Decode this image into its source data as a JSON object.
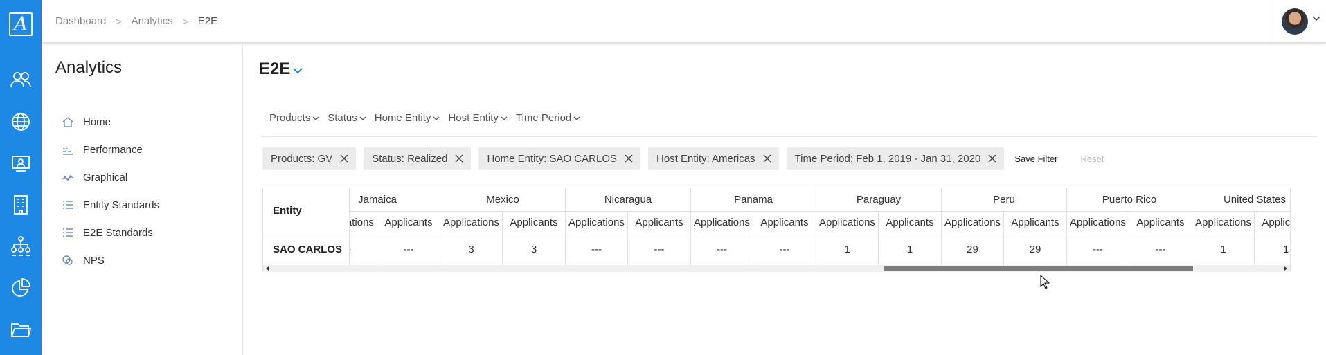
{
  "app": {
    "logo_letter": "A"
  },
  "breadcrumb": {
    "items": [
      "Dashboard",
      "Analytics",
      "E2E"
    ]
  },
  "sidebar": {
    "title": "Analytics",
    "items": [
      {
        "label": "Home",
        "icon": "home-icon"
      },
      {
        "label": "Performance",
        "icon": "performance-icon"
      },
      {
        "label": "Graphical",
        "icon": "graph-icon"
      },
      {
        "label": "Entity Standards",
        "icon": "list-icon"
      },
      {
        "label": "E2E Standards",
        "icon": "list-icon"
      },
      {
        "label": "NPS",
        "icon": "nps-icon"
      }
    ]
  },
  "main": {
    "title": "E2E",
    "filters": [
      "Products",
      "Status",
      "Home Entity",
      "Host Entity",
      "Time Period"
    ],
    "chips": [
      "Products: GV",
      "Status: Realized",
      "Home Entity: SAO CARLOS",
      "Host Entity: Americas",
      "Time Period: Feb 1, 2019 - Jan 31, 2020"
    ],
    "save_filter": "Save Filter",
    "reset": "Reset"
  },
  "table": {
    "entity_header": "Entity",
    "row_entity": "SAO CARLOS",
    "sub_headers": [
      "Applications",
      "Applicants"
    ],
    "countries": [
      {
        "name": "Jamaica",
        "applications": "---",
        "applicants": "---"
      },
      {
        "name": "Mexico",
        "applications": "3",
        "applicants": "3"
      },
      {
        "name": "Nicaragua",
        "applications": "---",
        "applicants": "---"
      },
      {
        "name": "Panama",
        "applications": "---",
        "applicants": "---"
      },
      {
        "name": "Paraguay",
        "applications": "1",
        "applicants": "1"
      },
      {
        "name": "Peru",
        "applications": "29",
        "applicants": "29"
      },
      {
        "name": "Puerto Rico",
        "applications": "---",
        "applicants": "---"
      },
      {
        "name": "United States",
        "applications": "1",
        "applicants": "1"
      }
    ]
  },
  "colors": {
    "rail": "#1e88e5",
    "chip_bg": "#ececec",
    "accent": "#1e88e5"
  }
}
